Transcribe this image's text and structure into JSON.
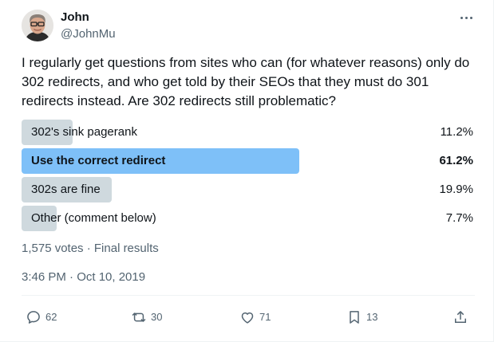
{
  "author": {
    "name": "John",
    "handle": "@JohnMu"
  },
  "tweet": {
    "text": "I regularly get questions from sites who can (for whatever reasons) only do 302 redirects, and who get told by their SEOs that they must do 301 redirects instead. Are 302 redirects still problematic?"
  },
  "poll": {
    "options": [
      {
        "label": "302's sink pagerank",
        "percent": "11.2%",
        "fraction": 0.112,
        "winner": false
      },
      {
        "label": "Use the correct redirect",
        "percent": "61.2%",
        "fraction": 0.612,
        "winner": true
      },
      {
        "label": "302s are fine",
        "percent": "19.9%",
        "fraction": 0.199,
        "winner": false
      },
      {
        "label": "Other (comment below)",
        "percent": "7.7%",
        "fraction": 0.077,
        "winner": false
      }
    ],
    "summary": "1,575 votes · Final results"
  },
  "timestamp": "3:46 PM · Oct 10, 2019",
  "actions": {
    "replies": "62",
    "reposts": "30",
    "likes": "71",
    "bookmarks": "13"
  },
  "colors": {
    "winner_bar": "#7ec0f8",
    "bar": "#cfd9de",
    "muted_text": "#536471"
  }
}
